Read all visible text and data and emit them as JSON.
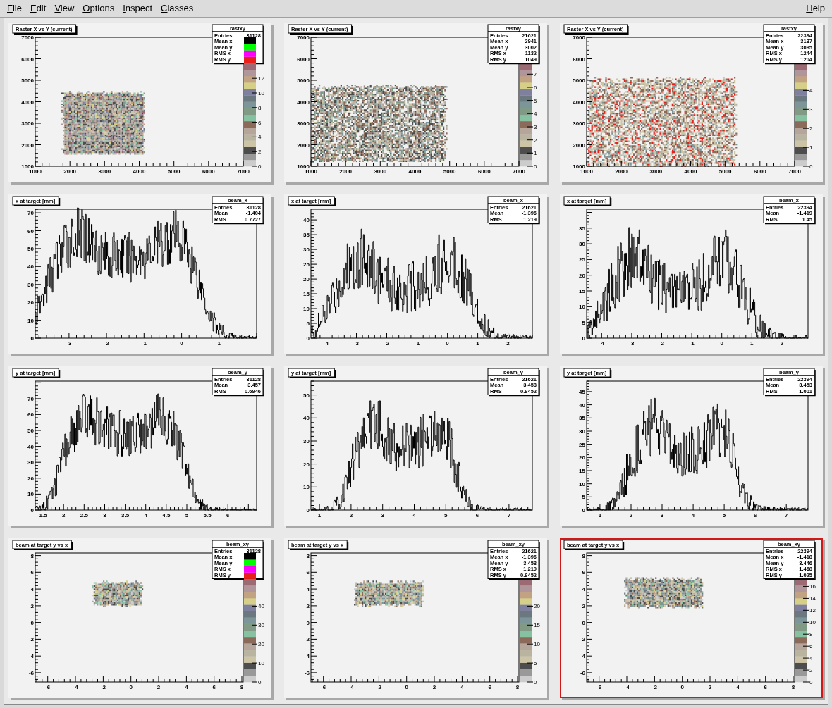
{
  "menu": [
    {
      "label": "File"
    },
    {
      "label": "Edit"
    },
    {
      "label": "View"
    },
    {
      "label": "Options"
    },
    {
      "label": "Inspect"
    },
    {
      "label": "Classes"
    }
  ],
  "help_menu": {
    "label": "Help"
  },
  "pads": [
    {
      "kind": "heatmap",
      "title": "Raster X vs Y (current)",
      "selected": false,
      "palette_over_stats": true,
      "stats": {
        "name": "rastxy",
        "rows": [
          {
            "label": "Entries",
            "value": "31128"
          },
          {
            "label": "Mean x"
          },
          {
            "label": "Mean y"
          },
          {
            "label": "RMS x"
          },
          {
            "label": "RMS y"
          }
        ]
      },
      "x_ticks": [
        "1000",
        "2000",
        "3000",
        "4000",
        "5000",
        "6000",
        "7000"
      ],
      "y_ticks": [
        "7000",
        "6000",
        "5000",
        "4000",
        "3000",
        "2000",
        "1000"
      ],
      "palette_ticks": [
        "12",
        "10",
        "8",
        "6",
        "4",
        "2",
        "0"
      ]
    },
    {
      "kind": "heatmap",
      "title": "Raster X vs Y (current)",
      "selected": false,
      "palette_over_stats": false,
      "stats": {
        "name": "rastxy",
        "rows": [
          {
            "label": "Entries",
            "value": "21621"
          },
          {
            "label": "Mean x",
            "value": "2941"
          },
          {
            "label": "Mean y",
            "value": "3002"
          },
          {
            "label": "RMS x",
            "value": "1132"
          },
          {
            "label": "RMS y",
            "value": "1049"
          }
        ]
      },
      "x_ticks": [
        "1000",
        "2000",
        "3000",
        "4000",
        "5000",
        "6000",
        "7000"
      ],
      "y_ticks": [
        "7000",
        "6000",
        "5000",
        "4000",
        "3000",
        "2000",
        "1000"
      ],
      "palette_ticks": [
        "7",
        "6",
        "5",
        "4",
        "3",
        "2",
        "1",
        "0"
      ]
    },
    {
      "kind": "heatmap",
      "title": "Raster X vs Y (current)",
      "selected": false,
      "palette_over_stats": false,
      "stats": {
        "name": "rastxy",
        "rows": [
          {
            "label": "Entries",
            "value": "22394"
          },
          {
            "label": "Mean x",
            "value": "3137"
          },
          {
            "label": "Mean y",
            "value": "3085"
          },
          {
            "label": "RMS x",
            "value": "1244"
          },
          {
            "label": "RMS y",
            "value": "1204"
          }
        ]
      },
      "x_ticks": [
        "1000",
        "2000",
        "3000",
        "4000",
        "5000",
        "6000",
        "7000"
      ],
      "y_ticks": [
        "7000",
        "6000",
        "5000",
        "4000",
        "3000",
        "2000",
        "1000"
      ],
      "palette_ticks": [
        "4",
        "3",
        "2",
        "1",
        "0"
      ]
    },
    {
      "kind": "histogram",
      "title": "x at target [mm]",
      "selected": false,
      "stats": {
        "name": "beam_x",
        "rows": [
          {
            "label": "Entries",
            "value": "31128"
          },
          {
            "label": "Mean",
            "value": "-1.404"
          },
          {
            "label": "RMS",
            "value": "0.7727"
          }
        ]
      },
      "x_ticks": [
        "-3",
        "-2",
        "-1",
        "0",
        "1"
      ],
      "y_ticks": [
        "70",
        "60",
        "50",
        "40",
        "30",
        "20",
        "10",
        "0"
      ]
    },
    {
      "kind": "histogram",
      "title": "x at target [mm]",
      "selected": false,
      "stats": {
        "name": "beam_x",
        "rows": [
          {
            "label": "Entries",
            "value": "21621"
          },
          {
            "label": "Mean",
            "value": "-1.396"
          },
          {
            "label": "RMS",
            "value": "1.219"
          }
        ]
      },
      "x_ticks": [
        "-4",
        "-3",
        "-2",
        "-1",
        "0",
        "1",
        "2"
      ],
      "y_ticks": [
        "40",
        "35",
        "30",
        "25",
        "20",
        "15",
        "10",
        "5",
        "0"
      ]
    },
    {
      "kind": "histogram",
      "title": "x at target [mm]",
      "selected": false,
      "stats": {
        "name": "beam_x",
        "rows": [
          {
            "label": "Entries",
            "value": "22394"
          },
          {
            "label": "Mean",
            "value": "-1.419"
          },
          {
            "label": "RMS",
            "value": "1.45"
          }
        ]
      },
      "x_ticks": [
        "-4",
        "-3",
        "-2",
        "-1",
        "0",
        "1",
        "2"
      ],
      "y_ticks": [
        "35",
        "30",
        "25",
        "20",
        "15",
        "10",
        "5",
        "0"
      ]
    },
    {
      "kind": "histogram",
      "title": "y at target [mm]",
      "selected": false,
      "stats": {
        "name": "beam_y",
        "rows": [
          {
            "label": "Entries",
            "value": "31128"
          },
          {
            "label": "Mean",
            "value": "3.457"
          },
          {
            "label": "RMS",
            "value": "0.6946"
          }
        ]
      },
      "x_ticks": [
        "1.5",
        "2",
        "2.5",
        "3",
        "3.5",
        "4",
        "4.5",
        "5",
        "5.5",
        "6"
      ],
      "y_ticks": [
        "70",
        "60",
        "50",
        "40",
        "30",
        "20",
        "10",
        "0"
      ]
    },
    {
      "kind": "histogram",
      "title": "y at target [mm]",
      "selected": false,
      "stats": {
        "name": "beam_y",
        "rows": [
          {
            "label": "Entries",
            "value": "21621"
          },
          {
            "label": "Mean",
            "value": "3.458"
          },
          {
            "label": "RMS",
            "value": "0.8452"
          }
        ]
      },
      "x_ticks": [
        "1",
        "2",
        "3",
        "4",
        "5",
        "6",
        "7"
      ],
      "y_ticks": [
        "50",
        "40",
        "30",
        "20",
        "10",
        "0"
      ]
    },
    {
      "kind": "histogram",
      "title": "y at target [mm]",
      "selected": false,
      "stats": {
        "name": "beam_y",
        "rows": [
          {
            "label": "Entries",
            "value": "22394"
          },
          {
            "label": "Mean",
            "value": "3.453"
          },
          {
            "label": "RMS",
            "value": "1.001"
          }
        ]
      },
      "x_ticks": [
        "1",
        "2",
        "3",
        "4",
        "5",
        "6",
        "7"
      ],
      "y_ticks": [
        "45",
        "40",
        "35",
        "30",
        "25",
        "20",
        "15",
        "10",
        "5",
        "0"
      ]
    },
    {
      "kind": "heatmap",
      "title": "beam at target y vs x",
      "selected": false,
      "palette_over_stats": true,
      "stats": {
        "name": "beam_xy",
        "rows": [
          {
            "label": "Entries",
            "value": "31128"
          },
          {
            "label": "Mean x"
          },
          {
            "label": "Mean y"
          },
          {
            "label": "RMS x"
          },
          {
            "label": "RMS y"
          }
        ]
      },
      "x_ticks": [
        "-6",
        "-4",
        "-2",
        "0",
        "2",
        "4",
        "6",
        "8"
      ],
      "y_ticks": [
        "8",
        "6",
        "4",
        "2",
        "0",
        "-2",
        "-4",
        "-6"
      ],
      "palette_ticks": [
        "40",
        "30",
        "20",
        "10",
        "0"
      ]
    },
    {
      "kind": "heatmap",
      "title": "beam at target y vs x",
      "selected": false,
      "palette_over_stats": false,
      "stats": {
        "name": "beam_xy",
        "rows": [
          {
            "label": "Entries",
            "value": "21621"
          },
          {
            "label": "Mean x",
            "value": "-1.396"
          },
          {
            "label": "Mean y",
            "value": "3.458"
          },
          {
            "label": "RMS x",
            "value": "1.219"
          },
          {
            "label": "RMS y",
            "value": "0.8452"
          }
        ]
      },
      "x_ticks": [
        "-6",
        "-4",
        "-2",
        "0",
        "2",
        "4",
        "6",
        "8"
      ],
      "y_ticks": [
        "8",
        "6",
        "4",
        "2",
        "0",
        "-2",
        "-4",
        "-6"
      ],
      "palette_ticks": [
        "20",
        "15",
        "10",
        "5",
        "0"
      ]
    },
    {
      "kind": "heatmap",
      "title": "beam at target y vs x",
      "selected": true,
      "palette_over_stats": false,
      "stats": {
        "name": "beam_xy",
        "rows": [
          {
            "label": "Entries",
            "value": "22394"
          },
          {
            "label": "Mean x",
            "value": "-1.418"
          },
          {
            "label": "Mean y",
            "value": "3.446"
          },
          {
            "label": "RMS x",
            "value": "1.468"
          },
          {
            "label": "RMS y",
            "value": "1.025"
          }
        ]
      },
      "x_ticks": [
        "-6",
        "-4",
        "-2",
        "0",
        "2",
        "4",
        "6",
        "8"
      ],
      "y_ticks": [
        "8",
        "6",
        "4",
        "2",
        "0",
        "-2",
        "-4",
        "-6"
      ],
      "palette_ticks": [
        "16",
        "14",
        "12",
        "10",
        "8",
        "6",
        "4",
        "2",
        "0"
      ]
    }
  ]
}
